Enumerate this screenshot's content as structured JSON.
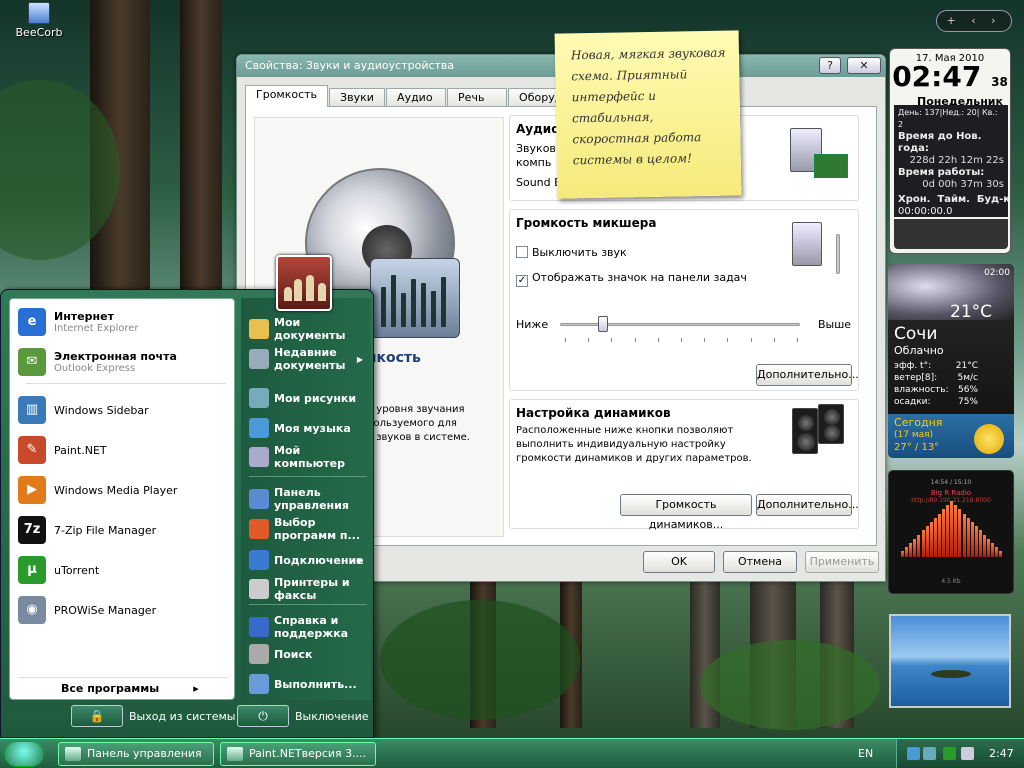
{
  "desktop": {
    "icons": [
      {
        "label": "BeeCorb",
        "icon": "computer-icon"
      }
    ]
  },
  "dialog": {
    "title": "Свойства: Звуки и аудиоустройства",
    "tabs": [
      "Громкость",
      "Звуки",
      "Аудио",
      "Речь",
      "Оборуд"
    ],
    "active_tab": "Громкость",
    "left_panel": {
      "title": "мкость",
      "desc": "о уровня звучания\nпользуемого для\nя звуков в системе."
    },
    "audio_group": {
      "title": "Аудио",
      "lines": [
        "Звуков",
        "компь",
        "Sound B"
      ]
    },
    "mixer_group": {
      "title": "Громкость микшера",
      "mute_label": "Выключить звук",
      "mute_checked": false,
      "tray_label": "Отображать значок на панели задач",
      "tray_checked": true,
      "low_label": "Ниже",
      "high_label": "Выше",
      "volume_level": 0.18,
      "advanced_btn": "Дополнительно..."
    },
    "speaker_group": {
      "title": "Настройка динамиков",
      "desc": "Расположенные ниже кнопки позволяют выполнить индивидуальную настройку громкости динамиков и других параметров.",
      "volume_btn": "Громкость динамиков...",
      "advanced_btn": "Дополнительно..."
    },
    "buttons": {
      "ok": "OK",
      "cancel": "Отмена",
      "apply": "Применить"
    },
    "help_btn": "?",
    "close_btn": "✕"
  },
  "sticky_note": {
    "text": "Новая, мягкая звуковая\nсхема. Приятный\nинтерфейс и\nстабильная,\nскоростная работа\nсистемы в целом!"
  },
  "start_menu": {
    "pinned": [
      {
        "name": "Интернет",
        "sub": "Internet Explorer",
        "icon": "internet-explorer-icon",
        "color": "#2a6fd6",
        "glyph": "e"
      },
      {
        "name": "Электронная почта",
        "sub": "Outlook Express",
        "icon": "outlook-express-icon",
        "color": "#5a9a3c",
        "glyph": "✉"
      }
    ],
    "recent": [
      {
        "name": "Windows Sidebar",
        "icon": "windows-sidebar-icon",
        "color": "#3a7ab8",
        "glyph": "▥"
      },
      {
        "name": "Paint.NET",
        "icon": "paint-net-icon",
        "color": "#c84a2a",
        "glyph": "✎"
      },
      {
        "name": "Windows Media Player",
        "icon": "media-player-icon",
        "color": "#e07a1a",
        "glyph": "▶"
      },
      {
        "name": "7-Zip File Manager",
        "icon": "seven-zip-icon",
        "color": "#111",
        "glyph": "7z"
      },
      {
        "name": "uTorrent",
        "icon": "utorrent-icon",
        "color": "#2a9a2a",
        "glyph": "µ"
      },
      {
        "name": "PROWiSe Manager",
        "icon": "prowise-icon",
        "color": "#7a8aa0",
        "glyph": "◉"
      }
    ],
    "all_programs": "Все программы",
    "right": [
      {
        "name": "Мои\nдокументы",
        "icon": "my-documents-icon",
        "color": "#e8c050"
      },
      {
        "name": "Недавние\nдокументы",
        "icon": "recent-documents-icon",
        "color": "#9ab",
        "arrow": true
      },
      {
        "name": "Мои рисунки",
        "icon": "my-pictures-icon",
        "color": "#7ab"
      },
      {
        "name": "Моя музыка",
        "icon": "my-music-icon",
        "color": "#4a9ad8"
      },
      {
        "name": "Мой\nкомпьютер",
        "icon": "my-computer-icon",
        "color": "#aac"
      },
      {
        "name": "Панель\nуправления",
        "icon": "control-panel-icon",
        "color": "#5a8ad0"
      },
      {
        "name": "Выбор\nпрограмм п...",
        "icon": "default-programs-icon",
        "color": "#e05a2a"
      },
      {
        "name": "Подключение",
        "icon": "network-icon",
        "color": "#3a7ad0",
        "arrow": true
      },
      {
        "name": "Принтеры и\nфаксы",
        "icon": "printer-icon",
        "color": "#ccc"
      },
      {
        "name": "Справка и\nподдержка",
        "icon": "help-icon",
        "color": "#3a6ac8"
      },
      {
        "name": "Поиск",
        "icon": "search-icon",
        "color": "#aaa"
      },
      {
        "name": "Выполнить...",
        "icon": "run-icon",
        "color": "#6a9ad8"
      }
    ],
    "logoff": "Выход из системы",
    "shutdown": "Выключение"
  },
  "taskbar": {
    "tasks": [
      {
        "label": "Панель управления",
        "icon": "control-panel-icon"
      },
      {
        "label": "Paint.NETверсия 3....",
        "icon": "paint-net-icon"
      }
    ],
    "language": "EN",
    "time": "2:47"
  },
  "gadgets": {
    "sidebar_controls": "+ ‹ ›",
    "clock": {
      "date": "17. Мая 2010",
      "time": "02:47",
      "seconds": "38",
      "weekday": "Понедельник",
      "day_line": "День: 137|Нед.: 20| Кв.: 2",
      "new_year_label": "Время до Нов. года:",
      "new_year_value": "228d 22h 12m 22s",
      "uptime_label": "Время работы:",
      "uptime_value": "0d 00h 37m 30s",
      "tabs_line": "Хрон.  Тайм.  Буд-к",
      "chrono": "00:00:00.0"
    },
    "weather": {
      "time": "02:00",
      "temp": "21°C",
      "city": "Сочи",
      "condition": "Облачно",
      "rows": [
        {
          "k": "эфф. t°:",
          "v": "21°C"
        },
        {
          "k": "ветер[8]:",
          "v": "5м/с"
        },
        {
          "k": "влажность:",
          "v": "56%"
        },
        {
          "k": "осадки:",
          "v": "75%"
        }
      ],
      "today_label": "Сегодня",
      "today_date": "(17 мая)",
      "today_temp": "27° / 13°"
    },
    "radio": {
      "time": "14:54 / 15:10",
      "station": "Big R Radio",
      "url": "http://80.190.21.218:8000",
      "freq": "4.5 Kb"
    }
  }
}
